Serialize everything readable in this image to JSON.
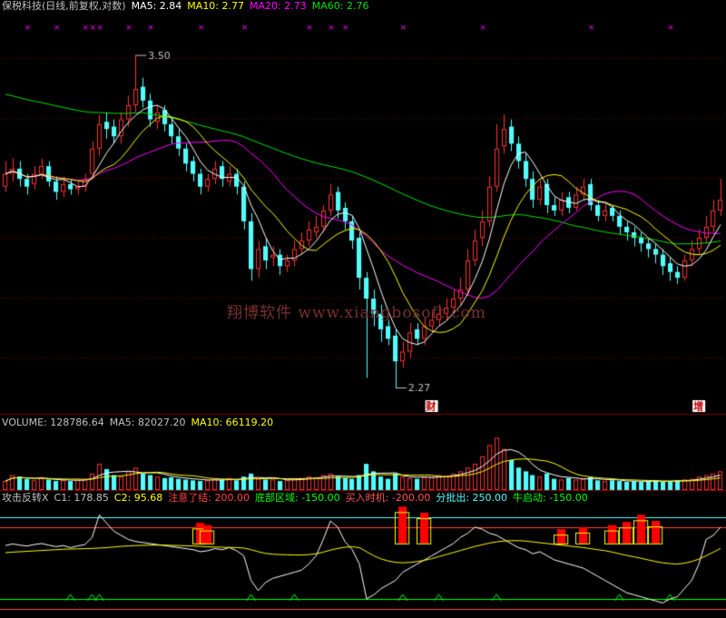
{
  "main_header": {
    "title": "保税科技(日线,前复权,对数)",
    "ma5": "MA5: 2.84",
    "ma10": "MA10: 2.77",
    "ma20": "MA20: 2.73",
    "ma60": "MA60: 2.76"
  },
  "volume_header": {
    "volume": "VOLUME: 128786.64",
    "ma5": "MA5: 82027.20",
    "ma10": "MA10: 66119.20"
  },
  "indicator_header": {
    "name": "攻击反转X",
    "c1": "C1: 178.85",
    "c2": "C2: 95.68",
    "attention": "注意了结: 200.00",
    "bottom": "底部区域: -150.00",
    "buy": "买入时机: -200.00",
    "batch": "分批出: 250.00",
    "bull": "牛启动: -150.00"
  },
  "watermark": "翔博软件 www.xiangbosoft.com",
  "colors": {
    "up": "#ff3232",
    "down": "#54fcfc",
    "ma5": "#ffffff",
    "ma10": "#ffff00",
    "ma20": "#ff00ff",
    "ma60": "#00e000",
    "grid": "#800000",
    "attention": "#ff4444",
    "bottom": "#00ff00",
    "buy": "#ff5555",
    "batch": "#54fcfc",
    "bull": "#00ff00"
  },
  "chart_data": {
    "type": "candlestick",
    "title": "保税科技(日线,前复权,对数)",
    "x_count": 100,
    "ylim": [
      2.2,
      3.7
    ],
    "high_annotation": {
      "index": 18,
      "value": 3.5,
      "label": "3.50"
    },
    "low_annotation": {
      "index": 54,
      "value": 2.27,
      "label": "2.27"
    },
    "event_markers": [
      {
        "index": 59,
        "label": "财"
      },
      {
        "index": 96,
        "label": "增"
      }
    ],
    "top_markers_x": [
      3,
      7,
      11,
      12,
      13,
      17,
      20,
      27,
      33,
      42,
      45,
      47,
      55,
      66,
      81,
      92
    ],
    "close": [
      3.0,
      3.02,
      2.98,
      2.95,
      3.0,
      3.03,
      2.97,
      2.93,
      2.96,
      2.94,
      2.95,
      2.98,
      3.1,
      3.2,
      3.18,
      3.15,
      3.22,
      3.28,
      3.35,
      3.3,
      3.22,
      3.25,
      3.2,
      3.15,
      3.1,
      3.04,
      3.0,
      2.95,
      2.98,
      3.02,
      2.98,
      3.0,
      2.95,
      2.82,
      2.65,
      2.72,
      2.68,
      2.7,
      2.66,
      2.68,
      2.72,
      2.75,
      2.79,
      2.8,
      2.86,
      2.92,
      2.86,
      2.82,
      2.75,
      2.62,
      2.55,
      2.5,
      2.45,
      2.42,
      2.35,
      2.38,
      2.44,
      2.42,
      2.46,
      2.48,
      2.5,
      2.52,
      2.55,
      2.58,
      2.68,
      2.75,
      2.82,
      2.95,
      3.1,
      3.18,
      3.12,
      3.05,
      2.98,
      2.9,
      2.95,
      2.88,
      2.86,
      2.9,
      2.87,
      2.92,
      2.95,
      2.88,
      2.84,
      2.86,
      2.84,
      2.8,
      2.78,
      2.76,
      2.74,
      2.72,
      2.7,
      2.66,
      2.64,
      2.62,
      2.68,
      2.72,
      2.76,
      2.8,
      2.86,
      2.9
    ],
    "open": [
      2.95,
      3.0,
      3.02,
      2.98,
      2.96,
      3.0,
      3.03,
      2.97,
      2.93,
      2.96,
      2.94,
      2.95,
      3.0,
      3.1,
      3.21,
      3.19,
      3.15,
      3.22,
      3.28,
      3.36,
      3.3,
      3.21,
      3.26,
      3.2,
      3.15,
      3.1,
      3.05,
      3.0,
      2.95,
      2.98,
      3.03,
      2.97,
      3.0,
      2.95,
      2.82,
      2.65,
      2.73,
      2.69,
      2.7,
      2.66,
      2.68,
      2.72,
      2.75,
      2.78,
      2.8,
      2.86,
      2.93,
      2.87,
      2.82,
      2.76,
      2.62,
      2.55,
      2.5,
      2.46,
      2.43,
      2.35,
      2.38,
      2.45,
      2.42,
      2.46,
      2.48,
      2.5,
      2.52,
      2.55,
      2.58,
      2.68,
      2.76,
      2.82,
      2.95,
      3.11,
      3.19,
      3.12,
      3.05,
      2.98,
      2.9,
      2.96,
      2.88,
      2.86,
      2.91,
      2.87,
      2.92,
      2.96,
      2.88,
      2.84,
      2.87,
      2.84,
      2.8,
      2.78,
      2.76,
      2.74,
      2.72,
      2.7,
      2.67,
      2.64,
      2.62,
      2.68,
      2.72,
      2.76,
      2.8,
      2.86
    ],
    "high": [
      3.05,
      3.06,
      3.05,
      3.0,
      3.03,
      3.06,
      3.05,
      2.99,
      2.99,
      2.98,
      2.97,
      3.0,
      3.13,
      3.24,
      3.25,
      3.22,
      3.25,
      3.32,
      3.5,
      3.4,
      3.33,
      3.28,
      3.28,
      3.23,
      3.18,
      3.12,
      3.07,
      3.02,
      3.0,
      3.05,
      3.05,
      3.03,
      3.02,
      2.97,
      2.85,
      2.75,
      2.76,
      2.73,
      2.72,
      2.7,
      2.75,
      2.78,
      2.82,
      2.84,
      2.88,
      2.96,
      2.95,
      2.89,
      2.84,
      2.78,
      2.64,
      2.58,
      2.53,
      2.48,
      2.45,
      2.41,
      2.47,
      2.47,
      2.49,
      2.51,
      2.53,
      2.55,
      2.58,
      2.62,
      2.72,
      2.79,
      2.86,
      2.99,
      3.2,
      3.24,
      3.22,
      3.15,
      3.08,
      3.01,
      2.98,
      2.98,
      2.91,
      2.93,
      2.93,
      2.95,
      2.98,
      2.98,
      2.9,
      2.89,
      2.88,
      2.86,
      2.82,
      2.8,
      2.78,
      2.76,
      2.74,
      2.72,
      2.69,
      2.66,
      2.7,
      2.75,
      2.79,
      2.84,
      2.9,
      2.98
    ],
    "low": [
      2.93,
      2.97,
      2.95,
      2.92,
      2.94,
      2.98,
      2.95,
      2.9,
      2.91,
      2.92,
      2.92,
      2.93,
      2.98,
      3.07,
      3.14,
      3.12,
      3.12,
      3.19,
      3.25,
      3.27,
      3.19,
      3.18,
      3.17,
      3.12,
      3.07,
      3.01,
      2.97,
      2.92,
      2.93,
      2.96,
      2.95,
      2.95,
      2.92,
      2.79,
      2.61,
      2.62,
      2.65,
      2.66,
      2.63,
      2.64,
      2.66,
      2.7,
      2.73,
      2.76,
      2.78,
      2.84,
      2.83,
      2.79,
      2.72,
      2.58,
      2.3,
      2.46,
      2.41,
      2.4,
      2.27,
      2.33,
      2.36,
      2.4,
      2.4,
      2.44,
      2.46,
      2.48,
      2.5,
      2.53,
      2.56,
      2.66,
      2.73,
      2.8,
      2.93,
      3.08,
      3.09,
      3.02,
      2.95,
      2.87,
      2.88,
      2.85,
      2.84,
      2.84,
      2.85,
      2.86,
      2.9,
      2.86,
      2.82,
      2.82,
      2.82,
      2.77,
      2.75,
      2.73,
      2.71,
      2.69,
      2.67,
      2.63,
      2.61,
      2.6,
      2.61,
      2.66,
      2.7,
      2.74,
      2.78,
      2.84
    ],
    "ma5": [],
    "ma10": [],
    "ma20": [],
    "ma60": [],
    "volume": [
      12,
      20,
      18,
      15,
      13,
      16,
      14,
      12,
      13,
      12,
      14,
      15,
      22,
      35,
      28,
      20,
      18,
      25,
      30,
      22,
      20,
      18,
      16,
      17,
      15,
      14,
      13,
      12,
      13,
      15,
      14,
      16,
      13,
      18,
      22,
      15,
      14,
      14,
      12,
      13,
      15,
      16,
      18,
      17,
      20,
      22,
      18,
      16,
      15,
      20,
      35,
      25,
      18,
      15,
      22,
      18,
      16,
      15,
      17,
      18,
      20,
      19,
      22,
      25,
      30,
      35,
      45,
      60,
      70,
      55,
      40,
      30,
      25,
      20,
      18,
      22,
      15,
      14,
      16,
      14,
      15,
      17,
      13,
      12,
      13,
      12,
      11,
      12,
      11,
      12,
      13,
      11,
      12,
      13,
      14,
      15,
      18,
      20,
      22,
      25
    ],
    "vol_ylim": [
      0,
      80
    ],
    "indicator": {
      "levels": {
        "batch": 250,
        "attention": 200,
        "bottom": -150,
        "buy": -200,
        "bull": -150
      },
      "ylim": [
        -230,
        310
      ],
      "c1": [
        110,
        118,
        112,
        108,
        115,
        120,
        112,
        105,
        110,
        100,
        108,
        115,
        150,
        260,
        220,
        180,
        160,
        140,
        130,
        125,
        120,
        115,
        110,
        105,
        100,
        95,
        90,
        80,
        85,
        95,
        90,
        100,
        85,
        60,
        -60,
        -110,
        -70,
        -50,
        -40,
        -30,
        -20,
        -10,
        20,
        60,
        140,
        230,
        200,
        130,
        90,
        20,
        -150,
        -130,
        -100,
        -80,
        -60,
        -20,
        0,
        20,
        40,
        60,
        80,
        100,
        120,
        150,
        170,
        200,
        190,
        170,
        160,
        140,
        120,
        100,
        90,
        70,
        80,
        60,
        40,
        30,
        20,
        10,
        0,
        -20,
        -40,
        -60,
        -80,
        -100,
        -120,
        -130,
        -140,
        -150,
        -160,
        -170,
        -150,
        -140,
        -100,
        -60,
        20,
        140,
        160,
        200
      ],
      "c2": [
        75,
        78,
        80,
        82,
        84,
        86,
        88,
        90,
        92,
        93,
        94,
        95,
        96,
        98,
        100,
        103,
        106,
        108,
        110,
        111,
        112,
        112,
        112,
        111,
        110,
        109,
        108,
        106,
        104,
        103,
        102,
        101,
        100,
        98,
        90,
        80,
        72,
        68,
        66,
        65,
        64,
        64,
        66,
        70,
        78,
        88,
        96,
        102,
        104,
        100,
        80,
        60,
        45,
        35,
        28,
        26,
        28,
        32,
        38,
        46,
        56,
        66,
        76,
        86,
        96,
        106,
        114,
        122,
        128,
        132,
        134,
        134,
        132,
        128,
        124,
        120,
        116,
        112,
        108,
        104,
        100,
        95,
        90,
        85,
        78,
        70,
        62,
        55,
        48,
        40,
        32,
        26,
        22,
        20,
        24,
        32,
        44,
        60,
        78,
        96
      ],
      "attention_bars": [
        {
          "index": 27,
          "value": 220
        },
        {
          "index": 28,
          "value": 210
        },
        {
          "index": 55,
          "value": 300
        },
        {
          "index": 58,
          "value": 270
        },
        {
          "index": 77,
          "value": 190
        },
        {
          "index": 80,
          "value": 200
        },
        {
          "index": 84,
          "value": 210
        },
        {
          "index": 86,
          "value": 225
        },
        {
          "index": 88,
          "value": 260
        },
        {
          "index": 90,
          "value": 230
        }
      ],
      "bull_markers": [
        9,
        12,
        13,
        34,
        40,
        55,
        60,
        68,
        85,
        92
      ]
    }
  }
}
